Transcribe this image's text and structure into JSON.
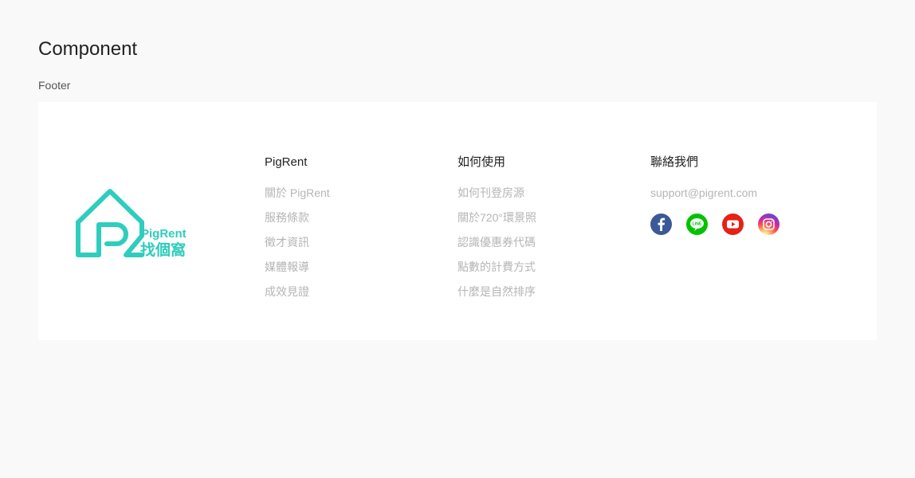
{
  "page": {
    "title": "Component",
    "section_label": "Footer"
  },
  "footer": {
    "logo": {
      "latin_text": "PigRent",
      "chinese_text": "找個窩",
      "color": "#2ecdbd"
    },
    "columns": [
      {
        "title": "PigRent",
        "links": [
          "關於 PigRent",
          "服務條款",
          "徵才資訊",
          "媒體報導",
          "成效見證"
        ]
      },
      {
        "title": "如何使用",
        "links": [
          "如何刊登房源",
          "關於720°環景照",
          "認識優惠券代碼",
          "點數的計費方式",
          "什麼是自然排序"
        ]
      }
    ],
    "contact": {
      "title": "聯絡我們",
      "email": "support@pigrent.com",
      "social": [
        {
          "icon": "facebook-icon",
          "color": "#3b5998"
        },
        {
          "icon": "line-icon",
          "color": "#00c300"
        },
        {
          "icon": "youtube-icon",
          "color": "#e62117"
        },
        {
          "icon": "instagram-icon",
          "color": "#d6249f"
        }
      ]
    }
  }
}
